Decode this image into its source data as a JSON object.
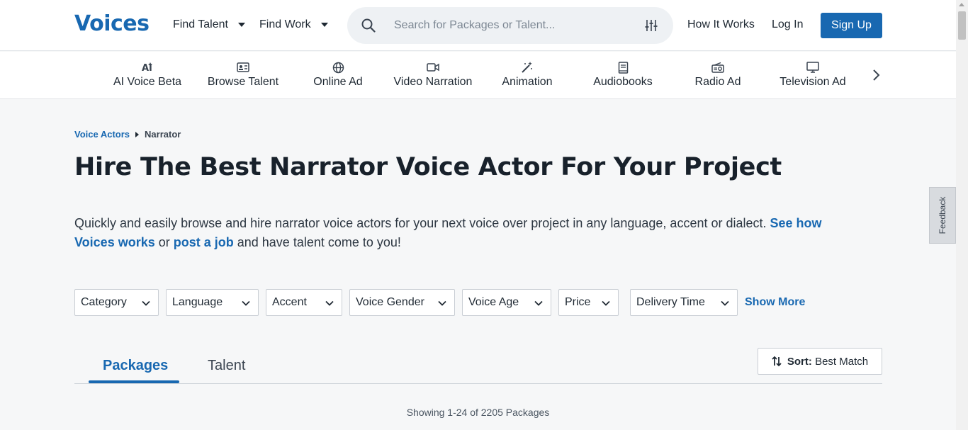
{
  "header": {
    "logo": "Voices",
    "find_talent": "Find Talent",
    "find_work": "Find Work",
    "search_placeholder": "Search for Packages or Talent...",
    "how_it_works": "How It Works",
    "log_in": "Log In",
    "sign_up": "Sign Up"
  },
  "categories": [
    {
      "label": "AI Voice Beta",
      "icon": "ai-icon"
    },
    {
      "label": "Browse Talent",
      "icon": "id-card-icon"
    },
    {
      "label": "Online Ad",
      "icon": "globe-icon"
    },
    {
      "label": "Video Narration",
      "icon": "video-camera-icon"
    },
    {
      "label": "Animation",
      "icon": "magic-wand-icon"
    },
    {
      "label": "Audiobooks",
      "icon": "book-icon"
    },
    {
      "label": "Radio Ad",
      "icon": "radio-icon"
    },
    {
      "label": "Television Ad",
      "icon": "monitor-icon"
    }
  ],
  "breadcrumb": {
    "parent": "Voice Actors",
    "current": "Narrator"
  },
  "page_title": "Hire The Best Narrator Voice Actor For Your Project",
  "intro": {
    "text_before": "Quickly and easily browse and hire narrator voice actors for your next voice over project in any language, accent or dialect. ",
    "link1": "See how Voices works",
    "text_mid": " or ",
    "link2": "post a job",
    "text_after": " and have talent come to you!"
  },
  "filters": [
    "Category",
    "Language",
    "Accent",
    "Voice Gender",
    "Voice Age",
    "Price",
    "Delivery Time"
  ],
  "show_more": "Show More",
  "tabs": {
    "packages": "Packages",
    "talent": "Talent"
  },
  "sort": {
    "prefix": "Sort:",
    "value": "Best Match"
  },
  "results_count": "Showing 1-24 of 2205 Packages",
  "feedback": "Feedback",
  "colors": {
    "brand": "#1868b1",
    "background": "#f6f7f8"
  }
}
